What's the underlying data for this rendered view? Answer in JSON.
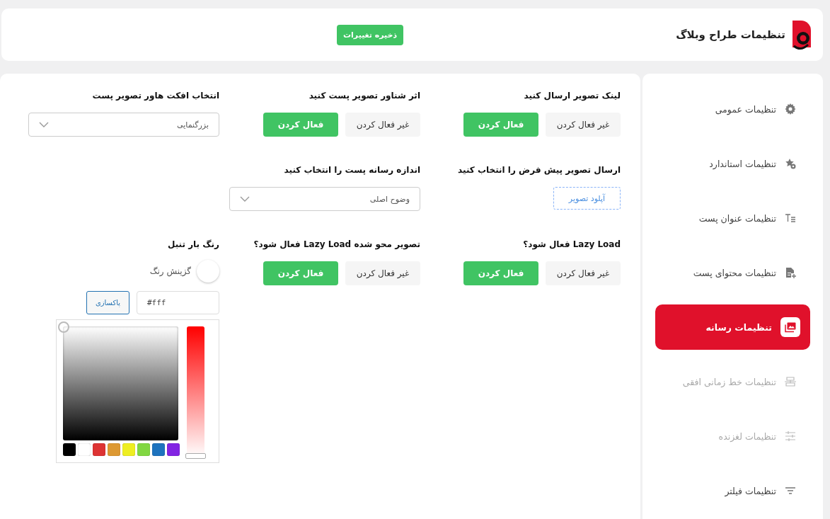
{
  "header": {
    "title": "تنظیمات طراح وبلاگ",
    "save_button": "ذخیره تغییرات"
  },
  "sidebar": {
    "items": [
      {
        "label": "تنظیمات عمومی",
        "kind": "gear",
        "selected": false,
        "disabled": false
      },
      {
        "label": "تنظیمات استاندارد",
        "kind": "star",
        "selected": false,
        "disabled": false
      },
      {
        "label": "تنظیمات عنوان پست",
        "kind": "text",
        "selected": false,
        "disabled": false
      },
      {
        "label": "تنظیمات محتوای پست",
        "kind": "file",
        "selected": false,
        "disabled": false
      },
      {
        "label": "تنظیمات رسانه",
        "kind": "images",
        "selected": true,
        "disabled": false
      },
      {
        "label": "تنظیمات خط زمانی افقی",
        "kind": "timeline",
        "selected": false,
        "disabled": true
      },
      {
        "label": "تنظیمات لغزنده",
        "kind": "sliders",
        "selected": false,
        "disabled": true
      },
      {
        "label": "تنظیمات فیلتر",
        "kind": "filter",
        "selected": false,
        "disabled": false
      }
    ]
  },
  "rows": [
    [
      {
        "kind": "toggle",
        "label": "لینک تصویر ارسال کنید",
        "options": [
          {
            "label": "غیر فعال کردن",
            "selected": false
          },
          {
            "label": "فعال کردن",
            "selected": true
          }
        ]
      },
      {
        "kind": "toggle",
        "label": "اثر شناور تصویر پست کنید",
        "options": [
          {
            "label": "غیر فعال کردن",
            "selected": false
          },
          {
            "label": "فعال کردن",
            "selected": true
          }
        ]
      },
      {
        "kind": "select",
        "label": "انتخاب افکت هاور تصویر پست",
        "value": "بزرگنمایی"
      }
    ],
    [
      {
        "kind": "upload",
        "label": "ارسال تصویر پیش فرض را انتخاب کنید",
        "button": "آپلود تصویر"
      },
      {
        "kind": "select",
        "label": "اندازه رسانه پست را انتخاب کنید",
        "value": "وضوح اصلی"
      }
    ],
    [
      {
        "kind": "toggle",
        "label": "Lazy Load فعال شود؟",
        "options": [
          {
            "label": "غیر فعال کردن",
            "selected": false
          },
          {
            "label": "فعال کردن",
            "selected": true
          }
        ]
      },
      {
        "kind": "toggle",
        "label": "تصویر محو شده Lazy Load فعال شود؟",
        "options": [
          {
            "label": "غیر فعال کردن",
            "selected": false
          },
          {
            "label": "فعال کردن",
            "selected": true
          }
        ]
      },
      {
        "kind": "color",
        "label": "رنگ بار تنبل",
        "picker_label": "گزینش رنگ",
        "value": "#fff",
        "clear_button": "پاکسازی",
        "hue": {
          "level": 0
        },
        "swatches": [
          {
            "color": "#000000"
          },
          {
            "color": "#ffffff"
          },
          {
            "color": "#dd3333"
          },
          {
            "color": "#dd9933"
          },
          {
            "color": "#eeee22"
          },
          {
            "color": "#81d742"
          },
          {
            "color": "#1e73be"
          },
          {
            "color": "#8224e3"
          }
        ]
      }
    ]
  ]
}
